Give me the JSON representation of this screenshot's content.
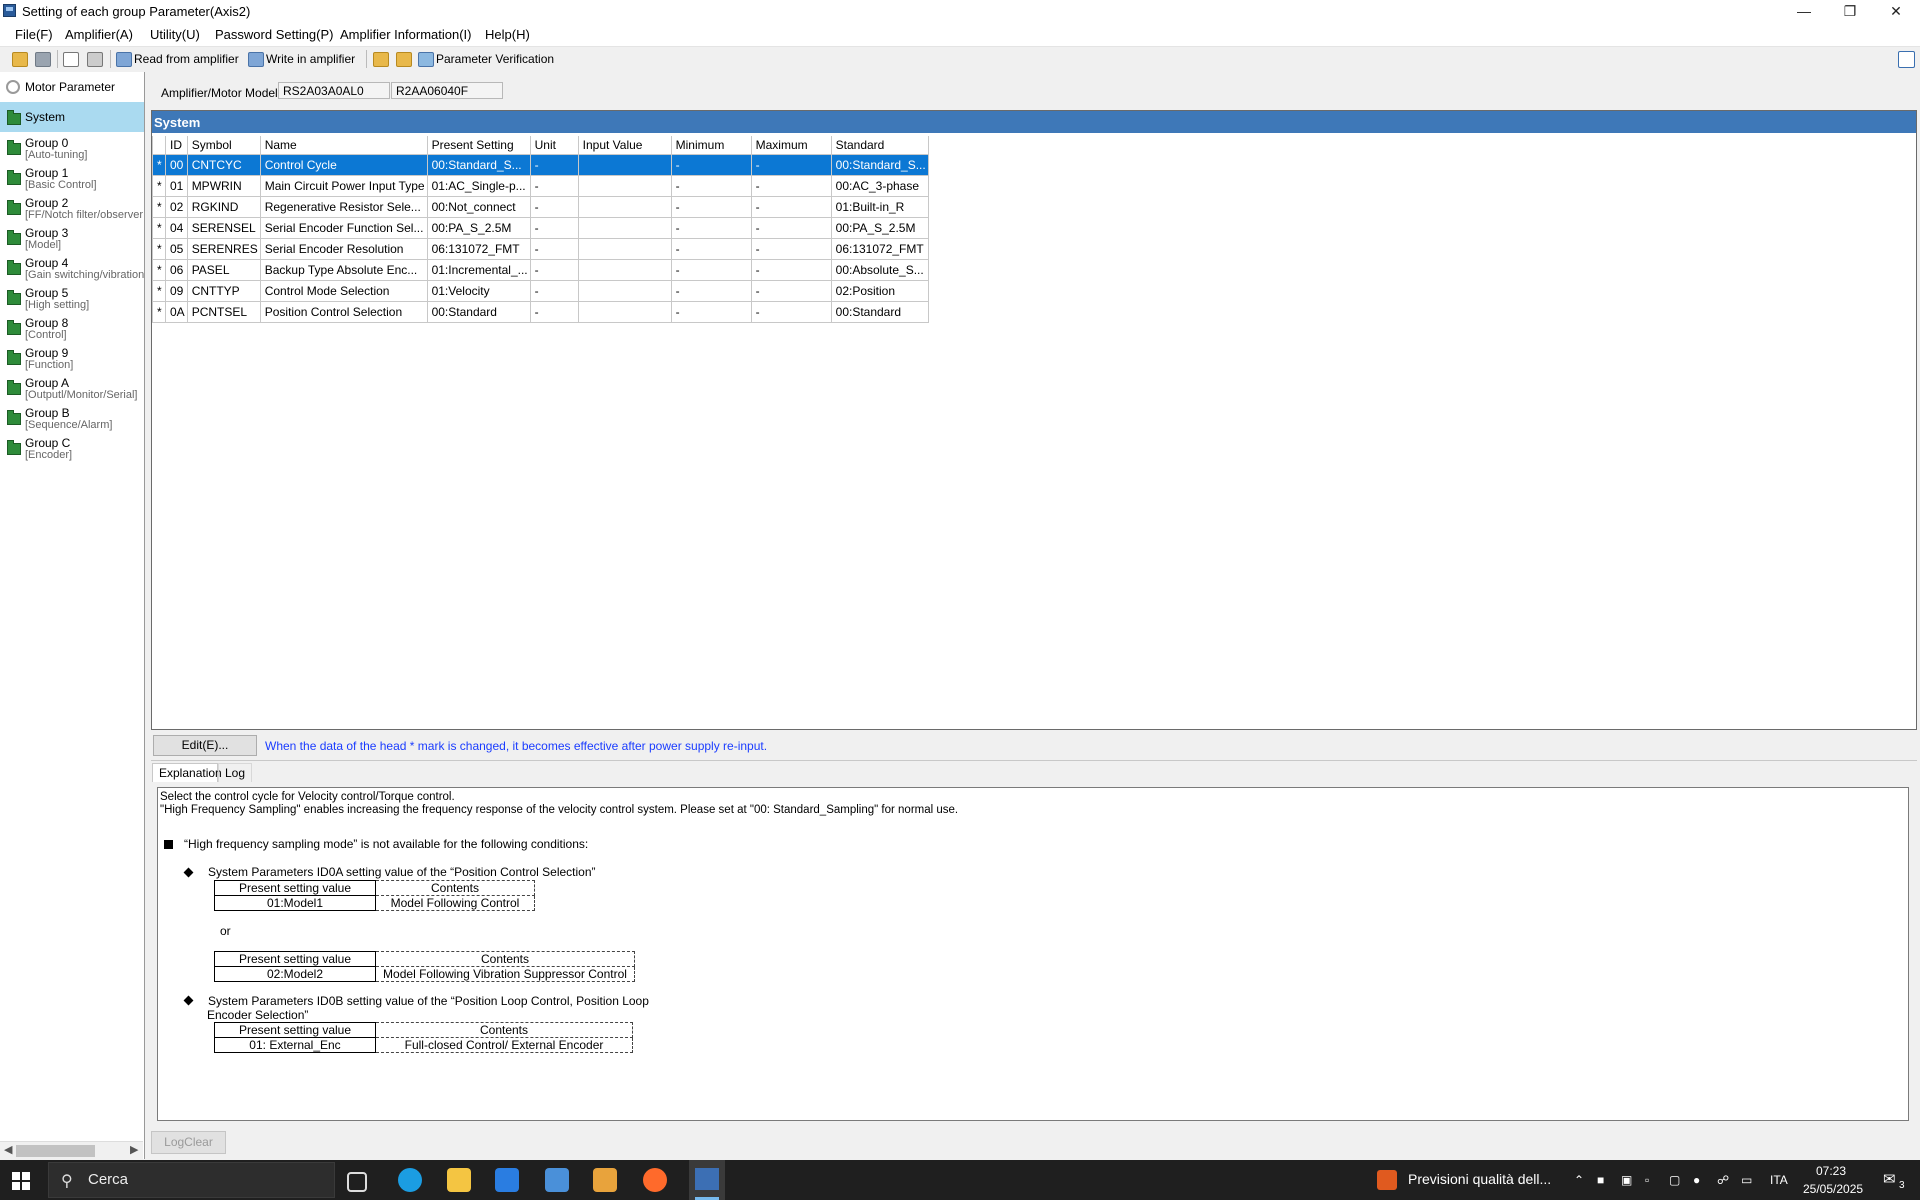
{
  "window": {
    "title": "Setting of each group Parameter(Axis2)",
    "minimize": "—",
    "restore": "❐",
    "close": "✕"
  },
  "menu": [
    "File(F)",
    "Amplifier(A)",
    "Utility(U)",
    "Password Setting(P)",
    "Amplifier Information(I)",
    "Help(H)"
  ],
  "toolbar": {
    "read_label": "Read from amplifier",
    "write_label": "Write in amplifier",
    "verify_label": "Parameter Verification"
  },
  "tree": {
    "motor_parameter": "Motor Parameter",
    "system": "System",
    "groups": [
      {
        "label": "Group 0",
        "sub": "[Auto-tuning]"
      },
      {
        "label": "Group 1",
        "sub": "[Basic Control]"
      },
      {
        "label": "Group 2",
        "sub": "[FF/Notch filter/observer"
      },
      {
        "label": "Group 3",
        "sub": "[Model]"
      },
      {
        "label": "Group 4",
        "sub": "[Gain switching/vibration"
      },
      {
        "label": "Group 5",
        "sub": "[High setting]"
      },
      {
        "label": "Group 8",
        "sub": "[Control]"
      },
      {
        "label": "Group 9",
        "sub": "[Function]"
      },
      {
        "label": "Group A",
        "sub": "[Outputl/Monitor/Serial]"
      },
      {
        "label": "Group B",
        "sub": "[Sequence/Alarm]"
      },
      {
        "label": "Group C",
        "sub": "[Encoder]"
      }
    ]
  },
  "model": {
    "label": "Amplifier/Motor Model",
    "amplifier": "RS2A03A0AL0",
    "motor": "R2AA06040F"
  },
  "section_title": "System",
  "table": {
    "headers": [
      "",
      "ID",
      "Symbol",
      "Name",
      "Present Setting",
      "Unit",
      "Input Value",
      "Minimum",
      "Maximum",
      "Standard"
    ],
    "rows": [
      [
        "*",
        "00",
        "CNTCYC",
        "Control Cycle",
        "00:Standard_S...",
        "-",
        "",
        "-",
        "-",
        "00:Standard_S..."
      ],
      [
        "*",
        "01",
        "MPWRIN",
        "Main Circuit Power Input Type",
        "01:AC_Single-p...",
        "-",
        "",
        "-",
        "-",
        "00:AC_3-phase"
      ],
      [
        "*",
        "02",
        "RGKIND",
        "Regenerative Resistor Sele...",
        "00:Not_connect",
        "-",
        "",
        "-",
        "-",
        "01:Built-in_R"
      ],
      [
        "*",
        "04",
        "SERENSEL",
        "Serial Encoder Function Sel...",
        "00:PA_S_2.5M",
        "-",
        "",
        "-",
        "-",
        "00:PA_S_2.5M"
      ],
      [
        "*",
        "05",
        "SERENRES",
        "Serial Encoder Resolution",
        "06:131072_FMT",
        "-",
        "",
        "-",
        "-",
        "06:131072_FMT"
      ],
      [
        "*",
        "06",
        "PASEL",
        "Backup Type Absolute Enc...",
        "01:Incremental_...",
        "-",
        "",
        "-",
        "-",
        "00:Absolute_S..."
      ],
      [
        "*",
        "09",
        "CNTTYP",
        "Control Mode Selection",
        "01:Velocity",
        "-",
        "",
        "-",
        "-",
        "02:Position"
      ],
      [
        "*",
        "0A",
        "PCNTSEL",
        "Position Control Selection",
        "00:Standard",
        "-",
        "",
        "-",
        "-",
        "00:Standard"
      ]
    ]
  },
  "edit_button": "Edit(E)...",
  "notice": "When the data of the head * mark is changed, it becomes effective after power supply re-input.",
  "tabs": {
    "explanation": "Explanation",
    "log": "Log"
  },
  "explanation": {
    "line1": "Select the control cycle for Velocity control/Torque control.",
    "line2": "\"High Frequency Sampling\" enables increasing the frequency response of the velocity control system. Please set at \"00: Standard_Sampling\" for normal use.",
    "heading": "“High frequency sampling mode” is not available for the following conditions:",
    "cond1": "System Parameters ID0A setting value of the “Position Control Selection”",
    "t1": {
      "h1": "Present setting value",
      "h2": "Contents",
      "v1": "01:Model1",
      "v2": "Model Following Control"
    },
    "or": "or",
    "t2": {
      "h1": "Present setting value",
      "h2": "Contents",
      "v1": "02:Model2",
      "v2": "Model Following Vibration Suppressor Control"
    },
    "cond2a": "System Parameters ID0B setting value of the “Position Loop Control, Position Loop",
    "cond2b": "Encoder Selection”",
    "t3": {
      "h1": "Present setting value",
      "h2": "Contents",
      "v1": "01: External_Enc",
      "v2": "Full-closed Control/ External Encoder"
    }
  },
  "log_clear": "LogClear",
  "taskbar": {
    "search": "Cerca",
    "weather": "Previsioni qualità dell...",
    "lang": "ITA",
    "time": "07:23",
    "date": "25/05/2025",
    "notif_count": "3"
  }
}
